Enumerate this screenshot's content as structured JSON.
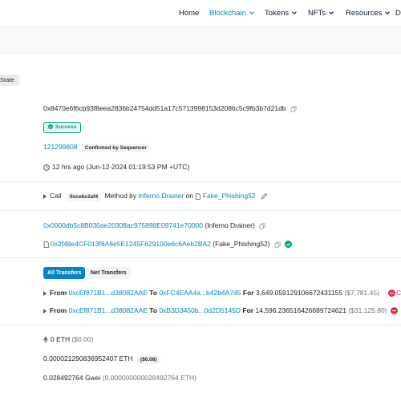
{
  "nav": {
    "items": [
      {
        "label": "Home"
      },
      {
        "label": "Blockchain"
      },
      {
        "label": "Tokens"
      },
      {
        "label": "NFTs"
      },
      {
        "label": "Resources"
      },
      {
        "label": "D"
      }
    ]
  },
  "tab_state": "State",
  "tx": {
    "hash": "0x8470e6f6cb93f8eea2836b24754dd51a17c5713998153d2086c5c9fb3b7d21db",
    "status": "Success",
    "block": "121299808",
    "block_badge": "Confirmed by Sequencer",
    "timestamp": "12 hrs ago (Jun-12-2024 01:19:53 PM +UTC)"
  },
  "action": {
    "call": "Call",
    "method_id": "0xcebc2af4",
    "method_by": "Method by",
    "drainer": "Inferno Drainer",
    "on": "on",
    "target": "Fake_Phishing52"
  },
  "from_to": {
    "from_address": "0x0000db5c8B030ae20308ac975898E09741e70000",
    "from_label": "(Inferno Drainer)",
    "to_address": "0x2f48e4CF013f8A8e5E1245F629100e6c6Aeb2BA2",
    "to_label": "(Fake_Phishing52)"
  },
  "transfers": {
    "tab_all": "All Transfers",
    "tab_net": "Net Transfers",
    "rows": [
      {
        "from_kw": "From",
        "from": "0xcEf871B1...d38082AAE",
        "to_kw": "To",
        "to": "0xFC4EAA4a...b42b4A745",
        "for_kw": "For",
        "amount": "3,649.059129106672431155",
        "usd": "($7,781.45)"
      },
      {
        "from_kw": "From",
        "from": "0xcEf871B1...d38082AAE",
        "to_kw": "To",
        "to": "0xB3D3450b...0d2D5145D",
        "for_kw": "For",
        "amount": "14,596.236516426689724621",
        "usd": "($31,125.80)"
      }
    ]
  },
  "value": {
    "eth": "0 ETH",
    "usd": "($0.00)"
  },
  "fee": {
    "eth": "0.000021290836952407 ETH",
    "usd": "($0.08)"
  },
  "gas": {
    "price": "0.028492764 Gwei",
    "eth": "(0.000000000028492764 ETH)"
  },
  "colors": {
    "link": "#0784c3",
    "success": "#00a186",
    "danger": "#dc3545"
  }
}
